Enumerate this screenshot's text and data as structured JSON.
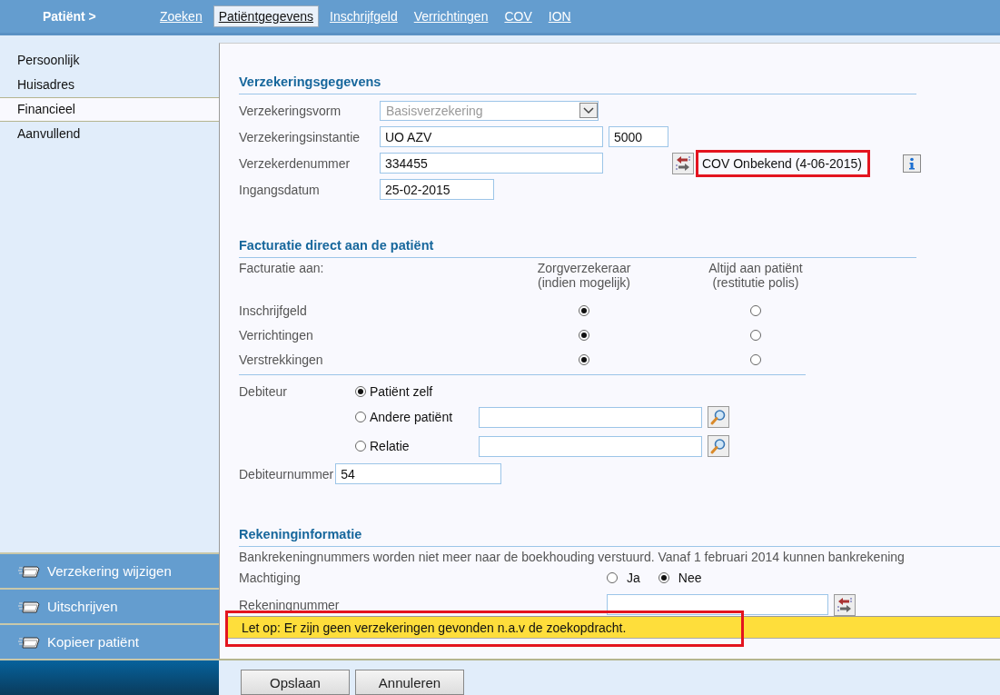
{
  "top_bar": {
    "title": "Patiënt >",
    "tabs": [
      {
        "label": "Zoeken",
        "selected": false
      },
      {
        "label": "Patiëntgegevens",
        "selected": true
      },
      {
        "label": "Inschrijfgeld",
        "selected": false
      },
      {
        "label": "Verrichtingen",
        "selected": false
      },
      {
        "label": "COV",
        "selected": false
      },
      {
        "label": "ION",
        "selected": false
      }
    ]
  },
  "sidebar": {
    "items": [
      {
        "label": "Persoonlijk",
        "selected": false
      },
      {
        "label": "Huisadres",
        "selected": false
      },
      {
        "label": "Financieel",
        "selected": true
      },
      {
        "label": "Aanvullend",
        "selected": false
      }
    ],
    "actions": [
      "Verzekering wijzigen",
      "Uitschrijven",
      "Kopieer patiënt"
    ]
  },
  "insurance": {
    "heading": "Verzekeringsgegevens",
    "fields": [
      {
        "kind": "select",
        "label": "Verzekeringsvorm",
        "value": "Basisverzekering",
        "disabled": true
      },
      {
        "kind": "pair",
        "label": "Verzekeringsinstantie",
        "value": "UO AZV",
        "value_2": "5000"
      },
      {
        "kind": "status",
        "label": "Verzekerdenummer",
        "value": "334455",
        "status": "COV Onbekend (4-06-2015)",
        "highlighted": true
      },
      {
        "kind": "date",
        "label": "Ingangsdatum",
        "value": "25-02-2015"
      }
    ]
  },
  "billing": {
    "heading": "Facturatie direct aan de patiënt",
    "caption": "Facturatie aan:",
    "columns": [
      "Zorgverzekeraar\n(indien mogelijk)",
      "Altijd aan patiënt\n(restitutie polis)"
    ],
    "rows": [
      {
        "label": "Inschrijfgeld",
        "options": [
          {
            "selected": true
          },
          {
            "selected": false
          }
        ]
      },
      {
        "label": "Verrichtingen",
        "options": [
          {
            "selected": true
          },
          {
            "selected": false
          }
        ]
      },
      {
        "label": "Verstrekkingen",
        "options": [
          {
            "selected": true
          },
          {
            "selected": false
          }
        ]
      }
    ]
  },
  "debtor": {
    "label": "Debiteur",
    "options": [
      {
        "kind": "plain",
        "label": "Patiënt zelf",
        "selected": true
      },
      {
        "kind": "search",
        "label": "Andere patiënt",
        "selected": false
      },
      {
        "kind": "search",
        "label": "Relatie",
        "selected": false
      }
    ],
    "number_label": "Debiteurnummer",
    "number_value": "54"
  },
  "account": {
    "heading": "Rekeninginformatie",
    "notice": "Bankrekeningnummers worden niet meer naar de boekhouding verstuurd. Vanaf 1 februari 2014 kunnen bankrekening",
    "mandate": {
      "label": "Machtiging",
      "options": [
        {
          "label": "Ja",
          "selected": false
        },
        {
          "label": "Nee",
          "selected": true
        }
      ]
    },
    "number_label": "Rekeningnummer"
  },
  "alert": {
    "text": "Let op: Er zijn geen verzekeringen gevonden n.a.v de zoekopdracht.",
    "highlighted": true
  },
  "buttons": [
    "Opslaan",
    "Annuleren"
  ]
}
